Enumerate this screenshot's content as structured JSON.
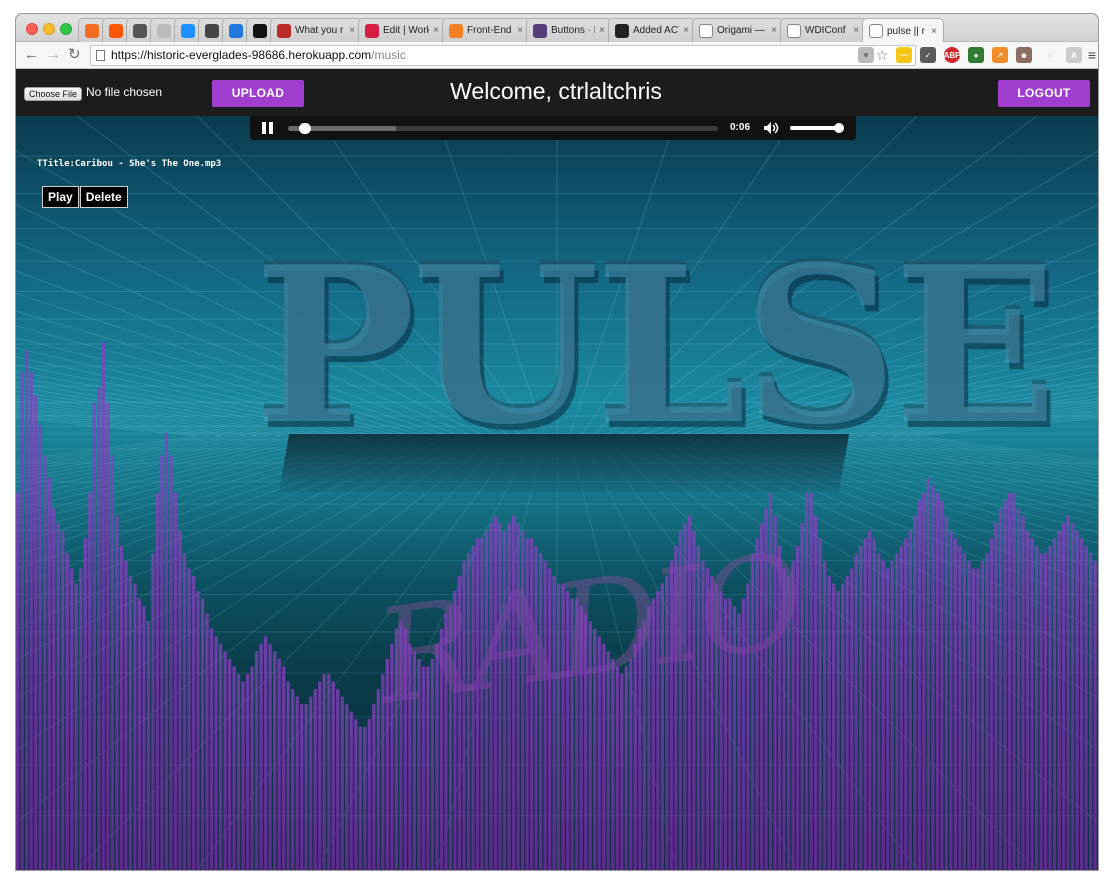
{
  "browser": {
    "tabs": [
      {
        "title": "",
        "icon": "music-icon",
        "color": "#f36c21"
      },
      {
        "title": "",
        "icon": "soundcloud-icon",
        "color": "#ff5500"
      },
      {
        "title": "",
        "icon": "cloud-icon",
        "color": "#555555"
      },
      {
        "title": "",
        "icon": "grid-icon",
        "color": "#bbbbbb"
      },
      {
        "title": "",
        "icon": "power-icon",
        "color": "#1e90ff"
      },
      {
        "title": "",
        "icon": "wifi-icon",
        "color": "#444444"
      },
      {
        "title": "",
        "icon": "trello-icon",
        "color": "#1f7ae0"
      },
      {
        "title": "",
        "icon": "circle-icon",
        "color": "#111111"
      },
      {
        "title": "What you r",
        "icon": "quora-icon",
        "color": "#b92b27"
      },
      {
        "title": "Edit | Work",
        "icon": "workshop-icon",
        "color": "#d61f43"
      },
      {
        "title": "Front-End C",
        "icon": "stack-icon",
        "color": "#f48024"
      },
      {
        "title": "Buttons · Bo",
        "icon": "bootstrap-icon",
        "color": "#563d7c"
      },
      {
        "title": "Added ACTI",
        "icon": "github-icon",
        "color": "#222222"
      },
      {
        "title": "Origami — D",
        "icon": "page-icon",
        "color": "#ffffff"
      },
      {
        "title": "WDIConf",
        "icon": "page-icon",
        "color": "#ffffff"
      },
      {
        "title": "pulse || r",
        "icon": "page-icon",
        "color": "#ffffff"
      }
    ],
    "url_host": "https://historic-everglades-98686.herokuapp.com",
    "url_path": "/music"
  },
  "header": {
    "choose_file_label": "Choose File",
    "file_status": "No file chosen",
    "upload_label": "UPLOAD",
    "welcome": "Welcome, ctrlaltchris",
    "logout_label": "LOGOUT"
  },
  "player": {
    "time": "0:06",
    "progress": 0.03,
    "buffered": 0.25,
    "volume": 1.0
  },
  "song": {
    "title": "TTitle:Caribou - She's The One.mp3",
    "play_label": "Play",
    "delete_label": "Delete"
  },
  "visual": {
    "big_text": "PULSE",
    "sub_text": "RADIO",
    "bar_color": "#8a3fc2",
    "bar_levels": [
      0.5,
      0.66,
      0.69,
      0.66,
      0.63,
      0.59,
      0.55,
      0.52,
      0.48,
      0.46,
      0.45,
      0.42,
      0.4,
      0.38,
      0.4,
      0.44,
      0.5,
      0.62,
      0.64,
      0.7,
      0.62,
      0.55,
      0.47,
      0.43,
      0.41,
      0.39,
      0.38,
      0.36,
      0.35,
      0.33,
      0.42,
      0.5,
      0.55,
      0.58,
      0.55,
      0.5,
      0.45,
      0.42,
      0.4,
      0.39,
      0.37,
      0.36,
      0.34,
      0.32,
      0.31,
      0.3,
      0.29,
      0.28,
      0.27,
      0.26,
      0.25,
      0.26,
      0.27,
      0.29,
      0.3,
      0.31,
      0.3,
      0.29,
      0.28,
      0.27,
      0.25,
      0.24,
      0.23,
      0.22,
      0.22,
      0.23,
      0.24,
      0.25,
      0.26,
      0.26,
      0.25,
      0.24,
      0.23,
      0.22,
      0.21,
      0.2,
      0.19,
      0.19,
      0.2,
      0.22,
      0.24,
      0.26,
      0.28,
      0.3,
      0.32,
      0.33,
      0.32,
      0.3,
      0.29,
      0.28,
      0.27,
      0.27,
      0.28,
      0.3,
      0.32,
      0.34,
      0.35,
      0.37,
      0.39,
      0.41,
      0.42,
      0.43,
      0.44,
      0.44,
      0.45,
      0.46,
      0.47,
      0.46,
      0.45,
      0.46,
      0.47,
      0.46,
      0.45,
      0.44,
      0.44,
      0.43,
      0.42,
      0.41,
      0.4,
      0.39,
      0.38,
      0.38,
      0.37,
      0.36,
      0.36,
      0.35,
      0.34,
      0.33,
      0.32,
      0.31,
      0.3,
      0.29,
      0.28,
      0.27,
      0.26,
      0.27,
      0.28,
      0.3,
      0.32,
      0.33,
      0.35,
      0.36,
      0.37,
      0.38,
      0.39,
      0.41,
      0.43,
      0.45,
      0.46,
      0.47,
      0.45,
      0.43,
      0.41,
      0.4,
      0.39,
      0.38,
      0.37,
      0.36,
      0.36,
      0.35,
      0.34,
      0.36,
      0.38,
      0.42,
      0.44,
      0.46,
      0.48,
      0.5,
      0.47,
      0.43,
      0.4,
      0.39,
      0.41,
      0.43,
      0.46,
      0.5,
      0.5,
      0.47,
      0.44,
      0.41,
      0.39,
      0.38,
      0.37,
      0.38,
      0.39,
      0.4,
      0.42,
      0.43,
      0.44,
      0.45,
      0.44,
      0.42,
      0.41,
      0.4,
      0.41,
      0.42,
      0.43,
      0.44,
      0.45,
      0.47,
      0.49,
      0.5,
      0.52,
      0.51,
      0.5,
      0.49,
      0.47,
      0.45,
      0.44,
      0.43,
      0.42,
      0.41,
      0.4,
      0.4,
      0.41,
      0.42,
      0.44,
      0.46,
      0.48,
      0.49,
      0.5,
      0.5,
      0.48,
      0.47,
      0.45,
      0.44,
      0.43,
      0.42,
      0.42,
      0.43,
      0.44,
      0.45,
      0.46,
      0.47,
      0.46,
      0.45,
      0.44,
      0.43,
      0.42,
      0.41
    ]
  }
}
